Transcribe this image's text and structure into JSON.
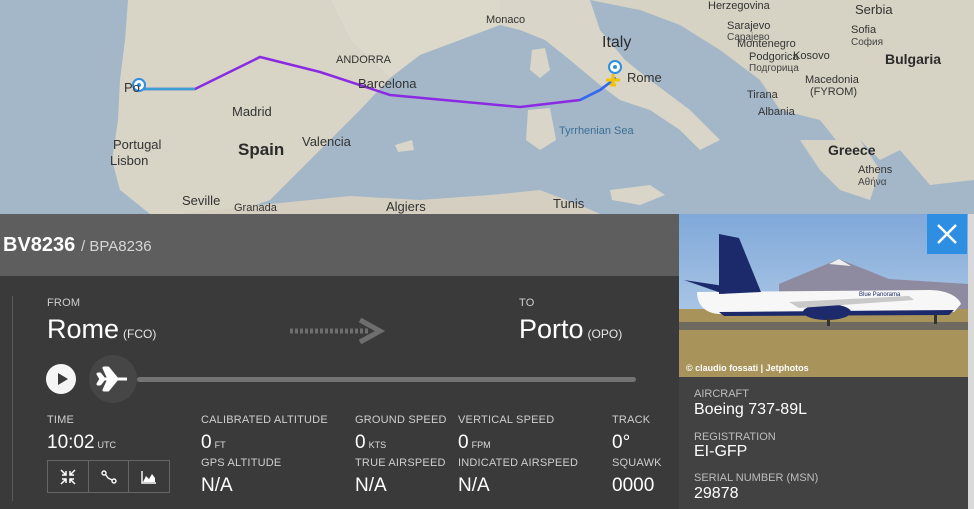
{
  "map": {
    "labels": {
      "monaco": "Monaco",
      "italy": "Italy",
      "rome": "Rome",
      "andorra": "ANDORRA",
      "barcelona": "Barcelona",
      "madrid": "Madrid",
      "spain": "Spain",
      "valencia": "Valencia",
      "portugal": "Portugal",
      "lisbon": "Lisbon",
      "seville": "Seville",
      "granada": "Granada",
      "algiers": "Algiers",
      "tunis": "Tunis",
      "tyrrhenian": "Tyrrhenian Sea",
      "herzegovina": "Herzegovina",
      "serbia": "Serbia",
      "sarajevo": "Sarajevo",
      "sarajevo_cyr": "Сарајево",
      "montenegro": "Montenegro",
      "podgorica": "Podgorica",
      "podgorica_cyr": "Подгорица",
      "kosovo": "Kosovo",
      "sofia": "Sofia",
      "sofia_cyr": "София",
      "bulgaria": "Bulgaria",
      "macedonia": "Macedonia",
      "fyrom": "(FYROM)",
      "tirana": "Tirana",
      "albania": "Albania",
      "greece": "Greece",
      "athens": "Athens",
      "athens_gr": "Αθήνα",
      "porto_partial": "Po"
    }
  },
  "flight": {
    "number": "BV8236",
    "callsign": "/ BPA8236"
  },
  "route": {
    "from_label": "FROM",
    "from_city": "Rome",
    "from_code": "(FCO)",
    "to_label": "TO",
    "to_city": "Porto",
    "to_code": "(OPO)"
  },
  "progress": {
    "fraction": 0.0
  },
  "stats": {
    "time_label": "TIME",
    "time_value": "10:02",
    "time_unit": "UTC",
    "cal_alt_label": "CALIBRATED ALTITUDE",
    "cal_alt_value": "0",
    "cal_alt_unit": "FT",
    "gps_alt_label": "GPS ALTITUDE",
    "gps_alt_value": "N/A",
    "ground_speed_label": "GROUND SPEED",
    "ground_speed_value": "0",
    "ground_speed_unit": "KTS",
    "true_airspeed_label": "TRUE AIRSPEED",
    "true_airspeed_value": "N/A",
    "vertical_speed_label": "VERTICAL SPEED",
    "vertical_speed_value": "0",
    "vertical_speed_unit": "FPM",
    "indicated_airspeed_label": "INDICATED AIRSPEED",
    "indicated_airspeed_value": "N/A",
    "track_label": "TRACK",
    "track_value": "0°",
    "squawk_label": "SQUAWK",
    "squawk_value": "0000"
  },
  "aircraft": {
    "photo_credit": "© claudio fossati | Jetphotos",
    "livery_text": "Blue Panorama",
    "aircraft_label": "AIRCRAFT",
    "aircraft_value": "Boeing 737-89L",
    "registration_label": "REGISTRATION",
    "registration_value": "EI-GFP",
    "serial_label": "SERIAL NUMBER (MSN)",
    "serial_value": "29878"
  },
  "icons": [
    "play-icon",
    "airplane-icon",
    "route-arrow-icon",
    "close-icon",
    "fullscreen-icon",
    "route-icon",
    "chart-icon",
    "location-pin-icon"
  ],
  "colors": {
    "accent": "#2d8ee2",
    "track_purple": "#8a2be2",
    "panel": "#3a3a3a",
    "header": "#5e5e5e"
  }
}
